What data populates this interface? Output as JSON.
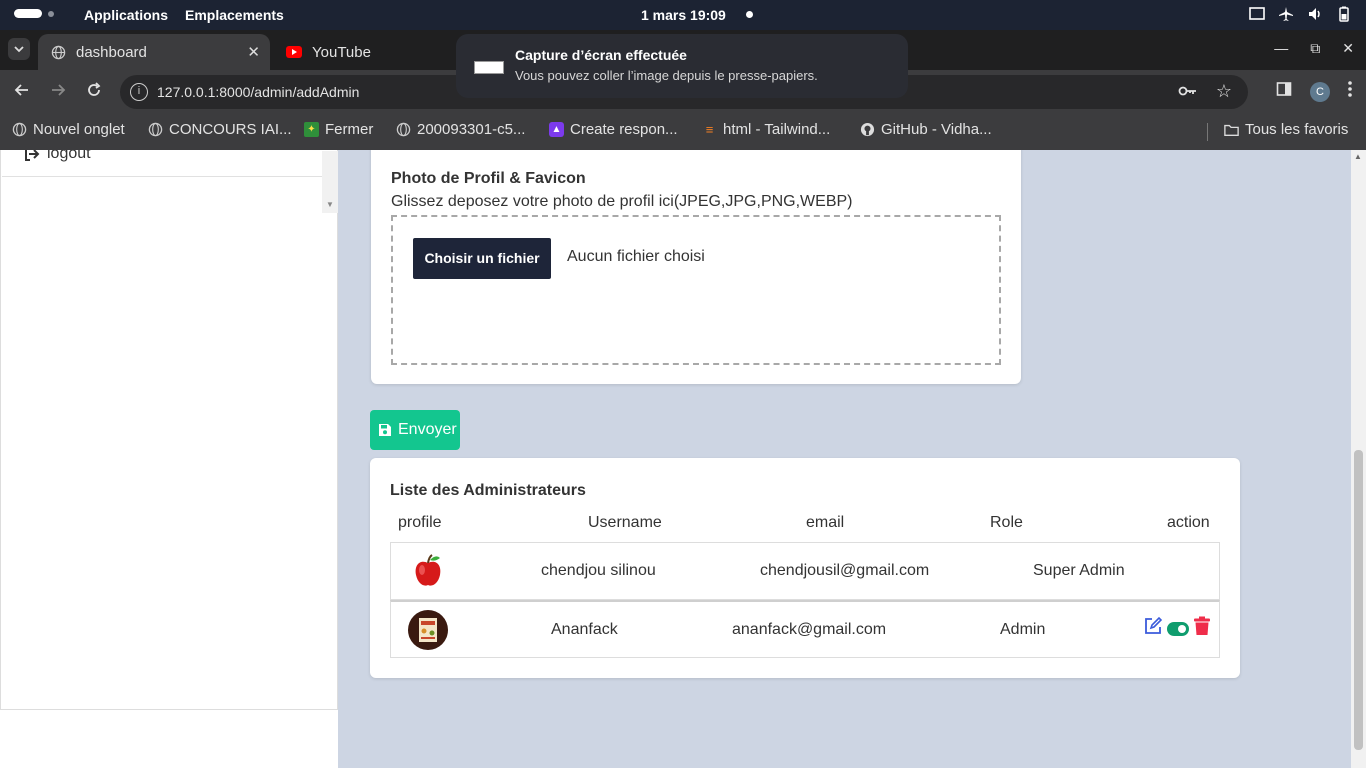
{
  "system": {
    "applications": "Applications",
    "places": "Emplacements",
    "clock": "1 mars  19:09"
  },
  "notification": {
    "title": "Capture d’écran effectuée",
    "body": "Vous pouvez coller l’image depuis le presse-papiers."
  },
  "browser": {
    "tabs": [
      {
        "label": "dashboard",
        "active": true
      },
      {
        "label": "YouTube",
        "active": false
      }
    ],
    "url": "127.0.0.1:8000/admin/addAdmin",
    "profile_initial": "C",
    "bookmarks": [
      {
        "label": "Nouvel onglet",
        "icon": "globe-icon"
      },
      {
        "label": "CONCOURS IAI...",
        "icon": "globe-icon"
      },
      {
        "label": "Fermer",
        "icon": "africa-map-icon"
      },
      {
        "label": "200093301-c5...",
        "icon": "globe-icon"
      },
      {
        "label": "Create respon...",
        "icon": "rocket-icon"
      },
      {
        "label": "html - Tailwind...",
        "icon": "stackoverflow-icon"
      },
      {
        "label": "GitHub - Vidha...",
        "icon": "github-icon"
      }
    ],
    "all_bookmarks": "Tous les favoris"
  },
  "sidebar": {
    "logout_label": "logout"
  },
  "upload": {
    "title": "Photo de Profil & Favicon",
    "hint": "Glissez deposez votre photo de profil ici(JPEG,JPG,PNG,WEBP)",
    "choose_button": "Choisir un fichier",
    "no_file": "Aucun fichier choisi"
  },
  "send_button": "Envoyer",
  "admins": {
    "title": "Liste des Administrateurs",
    "columns": [
      "profile",
      "Username",
      "email",
      "Role",
      "action"
    ],
    "rows": [
      {
        "username": "chendjou silinou",
        "email": "chendjousil@gmail.com",
        "role": "Super Admin",
        "avatar": "apple-avatar",
        "has_actions": false
      },
      {
        "username": "Ananfack",
        "email": "ananfack@gmail.com",
        "role": "Admin",
        "avatar": "photo-avatar",
        "has_actions": true,
        "active": true
      }
    ]
  },
  "colors": {
    "accent_green": "#13c68f",
    "dark_button": "#1e2539",
    "edit_blue": "#3b5bdb",
    "delete_red": "#ef2d4a"
  }
}
